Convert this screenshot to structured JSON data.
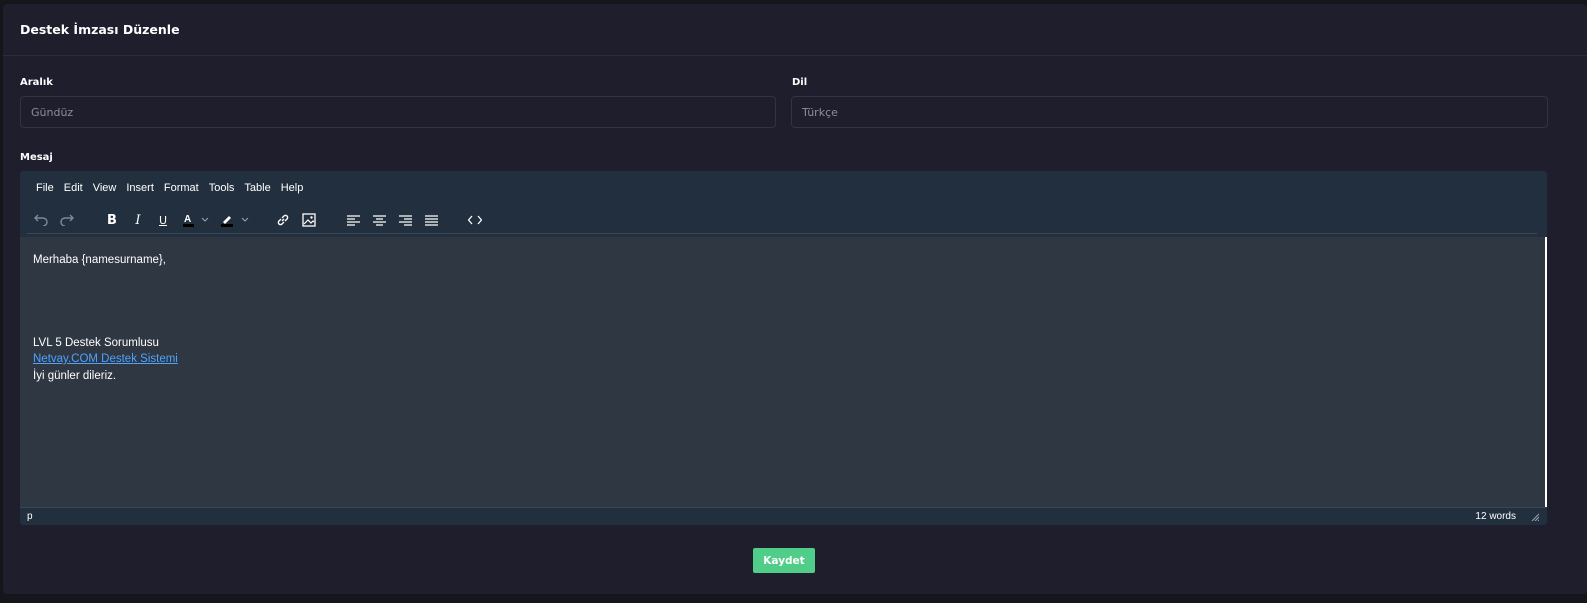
{
  "page": {
    "title": "Destek İmzası Düzenle"
  },
  "fields": {
    "aralik": {
      "label": "Aralık",
      "value": "Gündüz"
    },
    "dil": {
      "label": "Dil",
      "value": "Türkçe"
    },
    "mesaj": {
      "label": "Mesaj"
    }
  },
  "editor": {
    "menu": [
      "File",
      "Edit",
      "View",
      "Insert",
      "Format",
      "Tools",
      "Table",
      "Help"
    ],
    "toolbar_icons": [
      "undo-icon",
      "redo-icon",
      "bold-icon",
      "italic-icon",
      "underline-icon",
      "text-color-icon",
      "highlight-color-icon",
      "link-icon",
      "image-icon",
      "align-left-icon",
      "align-center-icon",
      "align-right-icon",
      "align-justify-icon",
      "source-code-icon"
    ],
    "content": {
      "greeting": "Merhaba {namesurname},",
      "signature_title": "LVL 5 Destek Sorumlusu",
      "signature_link": "Netvay.COM Destek Sistemi",
      "closing": "İyi günler dileriz."
    },
    "status": {
      "path": "p",
      "word_count": "12 words"
    }
  },
  "actions": {
    "save_label": "Kaydet"
  },
  "colors": {
    "background": "#15151c",
    "card": "#1e1e2d",
    "editor_chrome": "#222f3e",
    "editor_body": "#2f3742",
    "link": "#4da3ff",
    "save_button": "#50cd89"
  }
}
